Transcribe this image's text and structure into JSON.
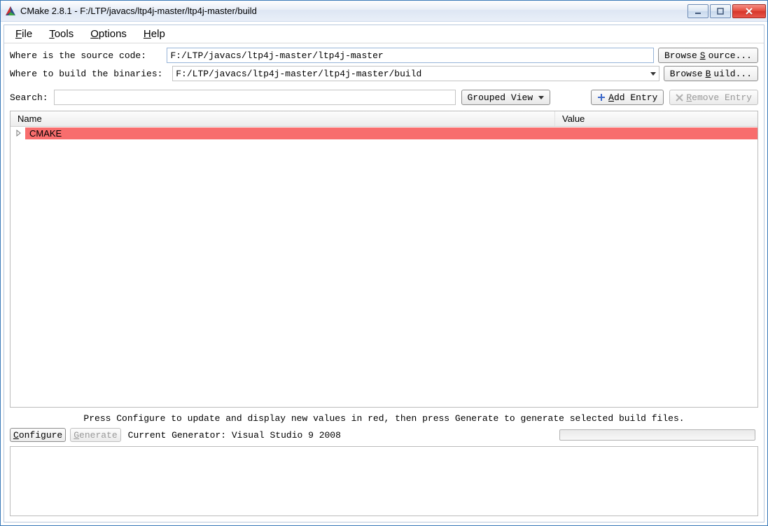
{
  "window": {
    "title": "CMake 2.8.1 - F:/LTP/javacs/ltp4j-master/ltp4j-master/build"
  },
  "menubar": {
    "file": "File",
    "tools": "Tools",
    "options": "Options",
    "help": "Help"
  },
  "form": {
    "source_label": "Where is the source code:   ",
    "source_value": "F:/LTP/javacs/ltp4j-master/ltp4j-master",
    "browse_source": "Browse Source...",
    "build_label": "Where to build the binaries: ",
    "build_value": "F:/LTP/javacs/ltp4j-master/ltp4j-master/build",
    "browse_build": "Browse Build..."
  },
  "search": {
    "label": "Search:",
    "value": "",
    "grouped_view": "Grouped View",
    "add_entry": "Add Entry",
    "remove_entry": "Remove Entry"
  },
  "columns": {
    "name": "Name",
    "value": "Value"
  },
  "tree": {
    "items": [
      {
        "label": "CMAKE"
      }
    ]
  },
  "hint": "Press Configure to update and display new values in red, then press Generate to generate selected build files.",
  "bottom": {
    "configure": "Configure",
    "generate": "Generate",
    "generator_text": "Current Generator: Visual Studio 9 2008"
  }
}
